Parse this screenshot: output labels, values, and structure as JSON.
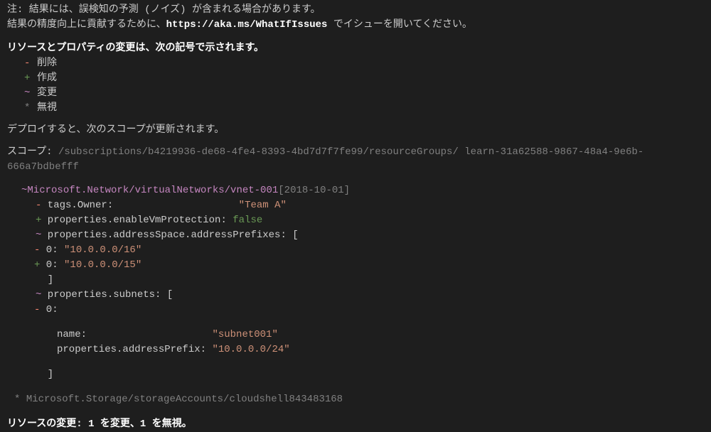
{
  "note": {
    "line1": "注: 結果には、誤検知の予測 (ノイズ) が含まれる場合があります。",
    "line2_prefix": " 結果の精度向上に貢献するために、",
    "line2_url": "https://aka.ms/WhatIfIssues",
    "line2_suffix": " でイシューを開いてください。"
  },
  "legend_heading": "リソースとプロパティの変更は、次の記号で示されます。",
  "legend": {
    "delete": {
      "symbol": "-",
      "label": "削除"
    },
    "create": {
      "symbol": "+",
      "label": "作成"
    },
    "modify": {
      "symbol": "~",
      "label": "変更"
    },
    "ignore": {
      "symbol": "*",
      "label": "無視"
    }
  },
  "deploy_heading": "デプロイすると、次のスコープが更新されます。",
  "scope": {
    "label": "スコープ: ",
    "value": "/subscriptions/b4219936-de68-4fe4-8393-4bd7d7f7fe99/resourceGroups/  learn-31a62588-9867-48a4-9e6b-666a7bdbefff"
  },
  "resource": {
    "symbol": "~ ",
    "id": "Microsoft.Network/virtualNetworks/vnet-001",
    "api": " [2018-10-01]",
    "props": {
      "tags_owner_sym": "-",
      "tags_owner_key": " tags.Owner:",
      "tags_owner_val": "\"Team A\"",
      "enable_vm_sym": "+",
      "enable_vm_key": " properties.enableVmProtection: ",
      "enable_vm_val": "false",
      "addr_space_sym": "~",
      "addr_space_key": " properties.addressSpace.addressPrefixes: [",
      "addr_old_sym": "-",
      "addr_old_key": " 0: ",
      "addr_old_val": "\"10.0.0.0/16\"",
      "addr_new_sym": "+",
      "addr_new_key": " 0: ",
      "addr_new_val": "\"10.0.0.0/15\"",
      "close_bracket": "  ]",
      "subnets_sym": "~",
      "subnets_key": " properties.subnets: [",
      "subnet_idx_sym": "-",
      "subnet_idx_key": " 0:",
      "subnet_name_key": "name:                     ",
      "subnet_name_val": "\"subnet001\"",
      "subnet_addr_key": "properties.addressPrefix: ",
      "subnet_addr_val": "\"10.0.0.0/24\"",
      "close_bracket2": "  ]"
    }
  },
  "ignored": {
    "symbol": "* ",
    "id": "Microsoft.Storage/storageAccounts/cloudshell843483168"
  },
  "summary": "リソースの変更: 1 を変更、1 を無視。"
}
